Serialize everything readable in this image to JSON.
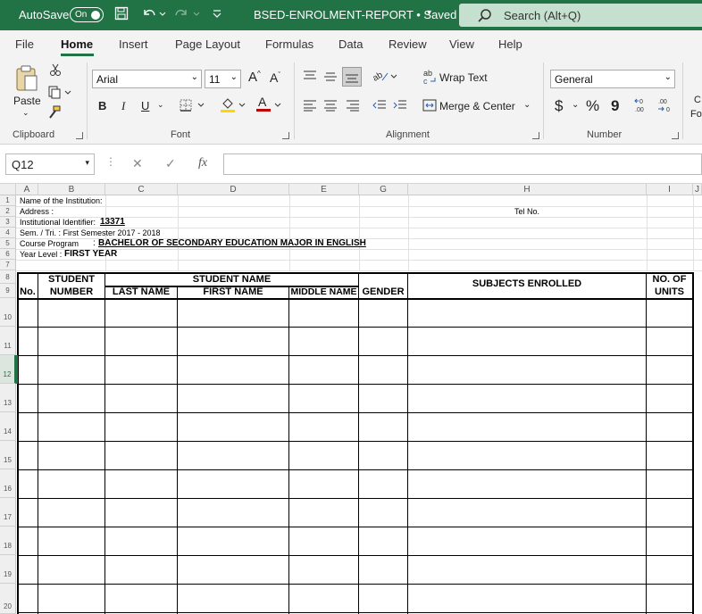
{
  "titlebar": {
    "autosave_label": "AutoSave",
    "autosave_state": "On",
    "doc_title": "BSED-ENROLMENT-REPORT • Saved",
    "search_placeholder": "Search (Alt+Q)"
  },
  "menu": {
    "tabs": [
      "File",
      "Home",
      "Insert",
      "Page Layout",
      "Formulas",
      "Data",
      "Review",
      "View",
      "Help"
    ],
    "active": "Home"
  },
  "ribbon": {
    "clipboard": {
      "paste_label": "Paste",
      "group_label": "Clipboard"
    },
    "font": {
      "font_name": "Arial",
      "font_size": "11",
      "group_label": "Font",
      "bold": "B",
      "italic": "I",
      "underline": "U"
    },
    "alignment": {
      "wrap_text": "Wrap Text",
      "merge_center": "Merge & Center",
      "group_label": "Alignment"
    },
    "number": {
      "format": "General",
      "group_label": "Number",
      "currency": "$",
      "percent": "%",
      "comma": "9"
    },
    "styles_partial": {
      "line1": "C",
      "line2": "Fo"
    }
  },
  "formula_bar": {
    "name_box": "Q12",
    "fx": "fx",
    "value": ""
  },
  "columns": [
    "A",
    "B",
    "C",
    "D",
    "E",
    "G",
    "H",
    "I",
    "J"
  ],
  "rows": [
    "1",
    "2",
    "3",
    "4",
    "5",
    "6",
    "7",
    "8",
    "9",
    "10",
    "11",
    "12",
    "13",
    "14",
    "15",
    "16",
    "17",
    "18",
    "19",
    "20"
  ],
  "selected_row": "12",
  "sheet": {
    "r1": "Name of the Institution:",
    "r2": "Address :",
    "r2_tel": "Tel No.",
    "r3_label": "Institutional Identifier:",
    "r3_value": "13371",
    "r4": "Sem. / Tri. : First Semester 2017 - 2018",
    "r5_label": "Course Program",
    "r5_value": "BACHELOR OF SECONDARY EDUCATION MAJOR IN ENGLISH",
    "r6_label": "Year Level :",
    "r6_value": "FIRST YEAR",
    "headers": {
      "no": "No.",
      "student_number_1": "STUDENT",
      "student_number_2": "NUMBER",
      "student_name": "STUDENT NAME",
      "last_name": "LAST NAME",
      "first_name": "FIRST NAME",
      "middle_name": "MIDDLE NAME",
      "gender": "GENDER",
      "subjects": "SUBJECTS ENROLLED",
      "units_1": "NO. OF",
      "units_2": "UNITS"
    }
  }
}
